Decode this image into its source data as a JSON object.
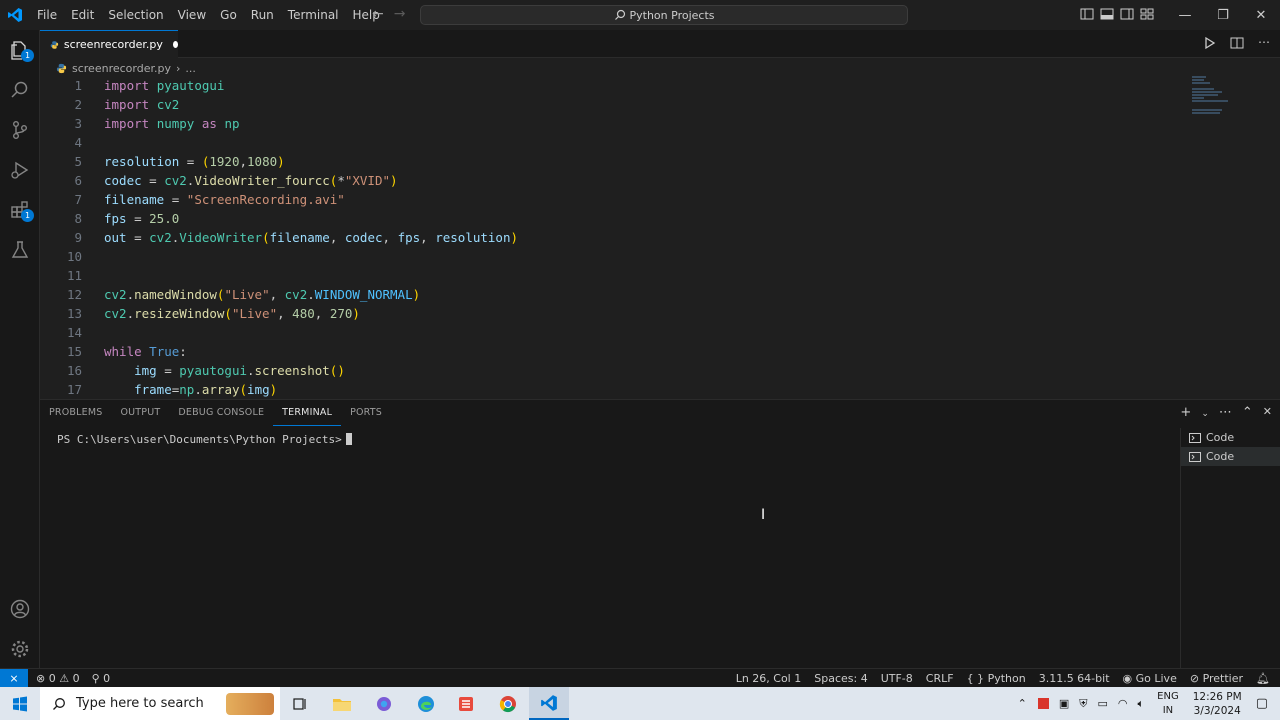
{
  "window": {
    "search_title": "Python Projects",
    "menu": [
      "File",
      "Edit",
      "Selection",
      "View",
      "Go",
      "Run",
      "Terminal",
      "Help"
    ]
  },
  "activity_bar": {
    "explorer_badge": "1",
    "extensions_badge": "1"
  },
  "tab": {
    "label": "screenrecorder.py",
    "modified": true
  },
  "breadcrumb": {
    "file": "screenrecorder.py",
    "more": "..."
  },
  "editor": {
    "line_numbers": [
      "1",
      "2",
      "3",
      "4",
      "5",
      "6",
      "7",
      "8",
      "9",
      "10",
      "11",
      "12",
      "13",
      "14",
      "15",
      "16",
      "17"
    ]
  },
  "panel": {
    "tabs": [
      "PROBLEMS",
      "OUTPUT",
      "DEBUG CONSOLE",
      "TERMINAL",
      "PORTS"
    ],
    "active_tab": "TERMINAL",
    "prompt": "PS C:\\Users\\user\\Documents\\Python Projects>",
    "terminals": [
      "Code",
      "Code"
    ]
  },
  "status_bar": {
    "errors": "0",
    "warnings": "0",
    "ports": "0",
    "position": "Ln 26, Col 1",
    "spaces": "Spaces: 4",
    "encoding": "UTF-8",
    "eol": "CRLF",
    "language": "Python",
    "interpreter": "3.11.5 64-bit",
    "go_live": "Go Live",
    "prettier": "Prettier"
  },
  "taskbar": {
    "search_placeholder": "Type here to search",
    "lang_line1": "ENG",
    "lang_line2": "IN",
    "time": "12:26 PM",
    "date": "3/3/2024"
  },
  "colors": {
    "accent": "#0078d4",
    "editor_bg": "#1f1f1f",
    "sidebar_bg": "#181818"
  }
}
